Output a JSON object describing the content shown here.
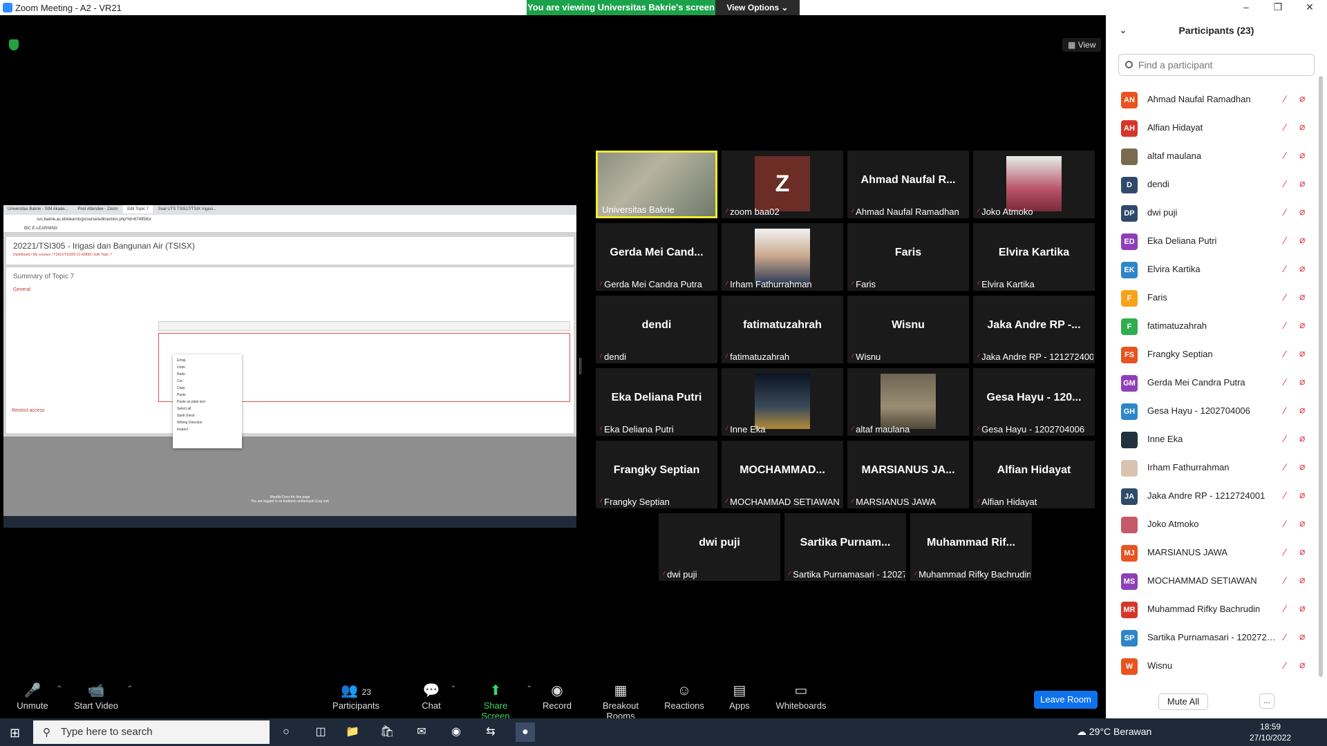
{
  "window": {
    "title": "Zoom Meeting - A2 - VR21",
    "banner": "You are viewing Universitas Bakrie's screen",
    "view_options": "View Options",
    "view_button": "View"
  },
  "shared_screen": {
    "tabs": [
      "Universitas Bakrie - SIM Akade...",
      "Post Attendee - Zoom",
      "Edit Topic 7",
      "Soal UTS TSI517/TSIX Irigasi..."
    ],
    "url": "svc.bakrie.ac.id/elearning/course/editsection.php?id=674958sr",
    "lms": "BIC E-LEARNING",
    "course_title": "20221/TSI305 - Irigasi dan Bangunan Air (TSISX)",
    "breadcrumb": "Dashboard / My courses / TSISX/TSI305-21-83898 / Edit Topic 7",
    "heading": "Summary of Topic 7",
    "general": "General",
    "restrict": "Restrict access",
    "context_menu": [
      "Emoji",
      "Undo",
      "Redo",
      "Cut",
      "Copy",
      "Paste",
      "Paste as plain text",
      "Select all",
      "Spell check",
      "Writing Direction",
      "Inspect"
    ],
    "footer": "Moodle Docs for this page",
    "footer2": "You are logged in as budianto ardiansyah (Log out)"
  },
  "tiles": [
    {
      "name": "Universitas Bakrie",
      "big": "",
      "type": "webcam",
      "active": true,
      "muted": false
    },
    {
      "name": "zoom baa02",
      "big": "",
      "type": "zavatar",
      "initial": "Z"
    },
    {
      "name": "Ahmad Naufal Ramadhan",
      "big": "Ahmad Naufal R...",
      "type": "text"
    },
    {
      "name": "Joko Atmoko",
      "big": "",
      "type": "photo_pink"
    },
    {
      "name": "Gerda Mei Candra Putra",
      "big": "Gerda Mei Cand...",
      "type": "text"
    },
    {
      "name": "Irham Fathurrahman",
      "big": "",
      "type": "photo_face"
    },
    {
      "name": "Faris",
      "big": "Faris",
      "type": "text"
    },
    {
      "name": "Elvira Kartika",
      "big": "Elvira Kartika",
      "type": "text"
    },
    {
      "name": "dendi",
      "big": "dendi",
      "type": "text"
    },
    {
      "name": "fatimatuzahrah",
      "big": "fatimatuzahrah",
      "type": "text"
    },
    {
      "name": "Wisnu",
      "big": "Wisnu",
      "type": "text"
    },
    {
      "name": "Jaka Andre RP - 1212724001",
      "big": "Jaka Andre RP -...",
      "type": "text"
    },
    {
      "name": "Eka Deliana Putri",
      "big": "Eka Deliana Putri",
      "type": "text"
    },
    {
      "name": "Inne Eka",
      "big": "",
      "type": "photo_night"
    },
    {
      "name": "altaf maulana",
      "big": "",
      "type": "photo_tree"
    },
    {
      "name": "Gesa Hayu - 1202704006",
      "big": "Gesa Hayu - 120...",
      "type": "text"
    },
    {
      "name": "Frangky Septian",
      "big": "Frangky Septian",
      "type": "text"
    },
    {
      "name": "MOCHAMMAD SETIAWAN",
      "big": "MOCHAMMAD...",
      "type": "text"
    },
    {
      "name": "MARSIANUS JAWA",
      "big": "MARSIANUS JA...",
      "type": "text"
    },
    {
      "name": "Alfian Hidayat",
      "big": "Alfian Hidayat",
      "type": "text"
    },
    {
      "name": "dwi puji",
      "big": "dwi puji",
      "type": "text"
    },
    {
      "name": "Sartika Purnamasari - 1202724...",
      "big": "Sartika Purnam...",
      "type": "text"
    },
    {
      "name": "Muhammad Rifky Bachrudin",
      "big": "Muhammad Rif...",
      "type": "text"
    }
  ],
  "toolbar": {
    "unmute": "Unmute",
    "start_video": "Start Video",
    "participants": "Participants",
    "participants_count": "23",
    "chat": "Chat",
    "share_screen": "Share Screen",
    "record": "Record",
    "breakout": "Breakout Rooms",
    "reactions": "Reactions",
    "apps": "Apps",
    "whiteboards": "Whiteboards",
    "leave": "Leave Room"
  },
  "panel": {
    "title": "Participants (23)",
    "search_placeholder": "Find a participant",
    "mute_all": "Mute All",
    "more": "...",
    "participants": [
      {
        "initials": "AN",
        "name": "Ahmad Naufal Ramadhan",
        "color": "#e8531f"
      },
      {
        "initials": "AH",
        "name": "Alfian Hidayat",
        "color": "#d6362a"
      },
      {
        "initials": "",
        "name": "altaf maulana",
        "color": "#7a6a50"
      },
      {
        "initials": "D",
        "name": "dendi",
        "color": "#2f4a6b"
      },
      {
        "initials": "DP",
        "name": "dwi puji",
        "color": "#2f4a6b"
      },
      {
        "initials": "ED",
        "name": "Eka Deliana Putri",
        "color": "#8e3fb8"
      },
      {
        "initials": "EK",
        "name": "Elvira Kartika",
        "color": "#2e86c9"
      },
      {
        "initials": "F",
        "name": "Faris",
        "color": "#f7a21b"
      },
      {
        "initials": "F",
        "name": "fatimatuzahrah",
        "color": "#2fae4e"
      },
      {
        "initials": "FS",
        "name": "Frangky Septian",
        "color": "#e8531f"
      },
      {
        "initials": "GM",
        "name": "Gerda Mei Candra Putra",
        "color": "#8e3fb8"
      },
      {
        "initials": "GH",
        "name": "Gesa Hayu - 1202704006",
        "color": "#2e86c9"
      },
      {
        "initials": "",
        "name": "Inne Eka",
        "color": "#223040"
      },
      {
        "initials": "",
        "name": "Irham Fathurrahman",
        "color": "#d9c3b0"
      },
      {
        "initials": "JA",
        "name": "Jaka Andre RP - 1212724001",
        "color": "#2f4a6b"
      },
      {
        "initials": "",
        "name": "Joko Atmoko",
        "color": "#c45a6a"
      },
      {
        "initials": "MJ",
        "name": "MARSIANUS JAWA",
        "color": "#e8531f"
      },
      {
        "initials": "MS",
        "name": "MOCHAMMAD SETIAWAN",
        "color": "#8e3fb8"
      },
      {
        "initials": "MR",
        "name": "Muhammad Rifky Bachrudin",
        "color": "#d6362a"
      },
      {
        "initials": "SP",
        "name": "Sartika Purnamasari - 1202724...",
        "color": "#2e86c9"
      },
      {
        "initials": "W",
        "name": "Wisnu",
        "color": "#e8531f"
      }
    ]
  },
  "taskbar": {
    "search": "Type here to search",
    "weather": "29°C Berawan",
    "time": "18:59",
    "date": "27/10/2022"
  }
}
